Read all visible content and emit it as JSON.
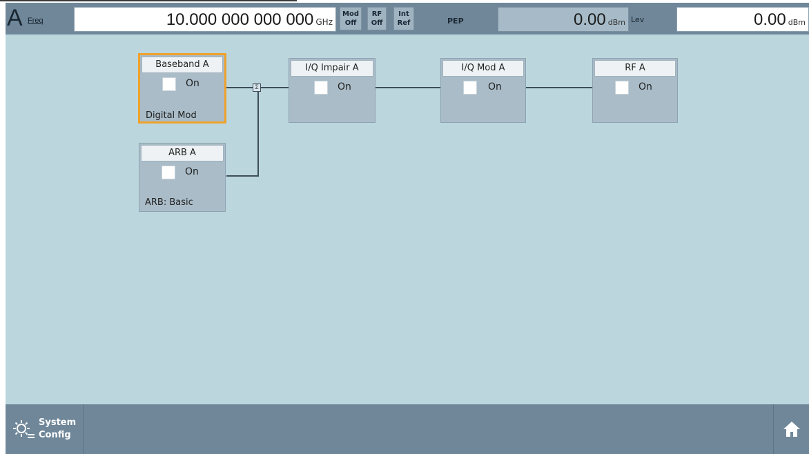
{
  "header": {
    "channel": "A",
    "freq_label": "Freq",
    "freq_value": "10.000 000 000 000",
    "freq_unit": "GHz",
    "tags": [
      {
        "line1": "Mod",
        "line2": "Off"
      },
      {
        "line1": "RF",
        "line2": "Off"
      },
      {
        "line1": "Int",
        "line2": "Ref"
      }
    ],
    "pep_label": "PEP",
    "pep_value": "0.00",
    "pep_unit": "dBm",
    "lev_label": "Lev",
    "lev_value": "0.00",
    "lev_unit": "dBm"
  },
  "blocks": {
    "baseband": {
      "title": "Baseband A",
      "on_label": "On",
      "sub": "Digital Mod"
    },
    "arb": {
      "title": "ARB A",
      "on_label": "On",
      "sub": "ARB: Basic"
    },
    "iq_impair": {
      "title": "I/Q Impair A",
      "on_label": "On"
    },
    "iq_mod": {
      "title": "I/Q Mod A",
      "on_label": "On"
    },
    "rf": {
      "title": "RF A",
      "on_label": "On"
    }
  },
  "sum_symbol": "Σ",
  "footer": {
    "system_line1": "System",
    "system_line2": "Config"
  },
  "colors": {
    "background": "#bcd6de",
    "bar": "#6f8799",
    "selected_border": "#f0a12a"
  }
}
